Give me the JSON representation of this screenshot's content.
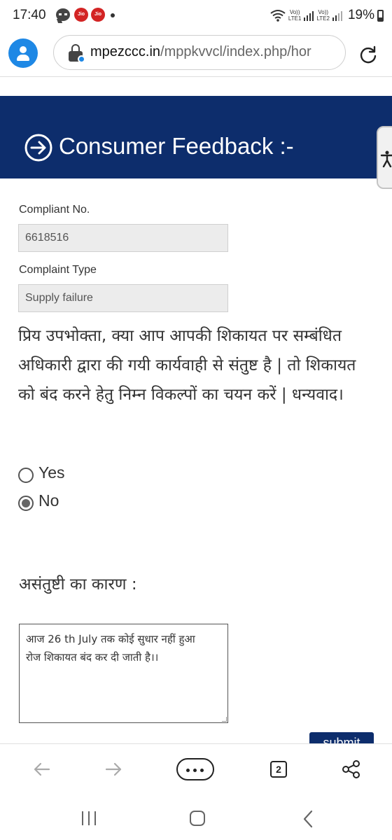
{
  "status_bar": {
    "time": "17:40",
    "carrier_badges": [
      "Jio",
      "Jio"
    ],
    "sim1_label": [
      "Vo))",
      "LTE1"
    ],
    "sim2_label": [
      "Vo))",
      "LTE2"
    ],
    "battery": "19%"
  },
  "browser": {
    "url_domain": "mpezccc.in",
    "url_path": "/mppkvvcl/index.php/hor",
    "tab_count": "2",
    "icons": {
      "profile": "avatar-icon",
      "site_info": "lock-icon",
      "reload": "reload-icon",
      "back": "back-arrow-icon",
      "forward": "forward-arrow-icon",
      "menu": "more-icon",
      "tabs": "tabs-icon",
      "share": "share-icon"
    }
  },
  "page": {
    "header_title": "Consumer Feedback :-",
    "accessibility_icon": "accessibility-icon",
    "complaint_no_label": "Compliant No.",
    "complaint_no_value": "6618516",
    "complaint_type_label": "Complaint Type",
    "complaint_type_value": "Supply failure",
    "message": "प्रिय उपभोक्ता, क्या आप आपकी शिकायत पर सम्बंधित अधिकारी द्वारा की गयी कार्यवाही से संतुष्ट है | तो शिकायत को बंद करने हेतु निम्न विकल्पों का चयन करें | धन्यवाद।",
    "options": [
      {
        "label": "Yes",
        "selected": false
      },
      {
        "label": "No",
        "selected": true
      }
    ],
    "reason_label": "असंतुष्टी का कारण :",
    "reason_text": "आज 26 th July तक कोई सुधार नहीं हुआ\nरोज शिकायत बंद कर दी जाती है।।",
    "submit_label": "submit",
    "colors": {
      "header_bg": "#0d2d6c",
      "avatar": "#1e88e5",
      "jio_red": "#d32424"
    }
  }
}
